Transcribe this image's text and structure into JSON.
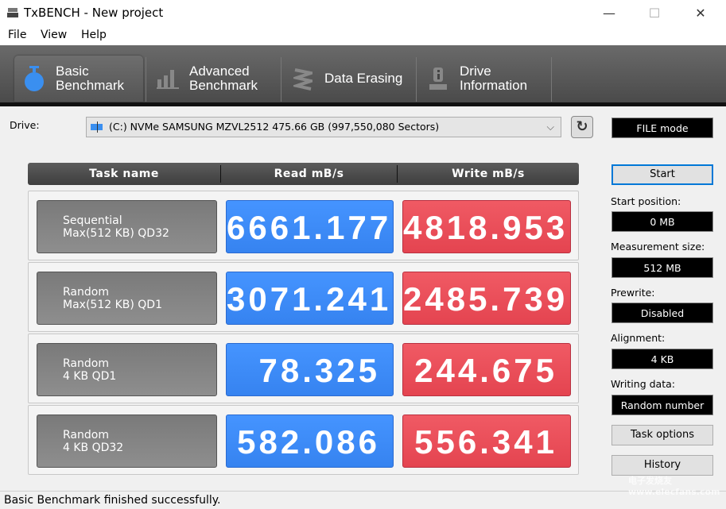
{
  "window": {
    "title": "TxBENCH - New project",
    "minimize": "—",
    "maximize": "☐",
    "close": "✕"
  },
  "menu": [
    "File",
    "View",
    "Help"
  ],
  "tabs": [
    {
      "label1": "Basic",
      "label2": "Benchmark",
      "icon": "stopwatch-icon",
      "active": true
    },
    {
      "label1": "Advanced",
      "label2": "Benchmark",
      "icon": "bar-chart-icon",
      "active": false
    },
    {
      "label1": "Data Erasing",
      "label2": "",
      "icon": "eraser-icon",
      "active": false
    },
    {
      "label1": "Drive",
      "label2": "Information",
      "icon": "drive-info-icon",
      "active": false
    }
  ],
  "drive": {
    "label": "Drive:",
    "value": "(C:) NVMe SAMSUNG MZVL2512  475.66 GB (997,550,080 Sectors)",
    "mode": "FILE mode"
  },
  "table": {
    "headers": [
      "Task name",
      "Read mB/s",
      "Write mB/s"
    ],
    "rows": [
      {
        "name1": "Sequential",
        "name2": "Max(512 KB) QD32",
        "read": "6661.177",
        "write": "4818.953"
      },
      {
        "name1": "Random",
        "name2": "Max(512 KB) QD1",
        "read": "3071.241",
        "write": "2485.739"
      },
      {
        "name1": "Random",
        "name2": "4 KB QD1",
        "read": "78.325",
        "write": "244.675"
      },
      {
        "name1": "Random",
        "name2": "4 KB QD32",
        "read": "582.086",
        "write": "556.341"
      }
    ]
  },
  "side": {
    "start": "Start",
    "start_position_label": "Start position:",
    "start_position": "0 MB",
    "measurement_size_label": "Measurement size:",
    "measurement_size": "512 MB",
    "prewrite_label": "Prewrite:",
    "prewrite": "Disabled",
    "alignment_label": "Alignment:",
    "alignment": "4 KB",
    "writing_data_label": "Writing data:",
    "writing_data": "Random number",
    "task_options": "Task options",
    "history": "History"
  },
  "status": "Basic Benchmark finished successfully.",
  "watermark": "电子发烧友 www.elecfans.com",
  "colors": {
    "read": "#3d8bf8",
    "write": "#ea4e5a",
    "toolbar": "#555555"
  }
}
